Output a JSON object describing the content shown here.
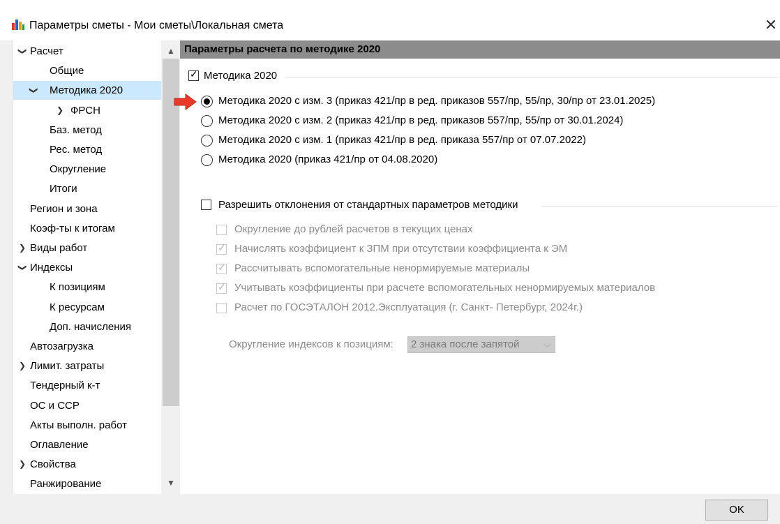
{
  "window": {
    "title": "Параметры сметы - Мои сметы\\Локальная смета",
    "close_symbol": "✕",
    "app_icon": "chart-app-icon"
  },
  "tree": {
    "items": [
      {
        "label": "Расчет",
        "arrow": "❯",
        "arrow_state": "expanded"
      },
      {
        "label": "Общие"
      },
      {
        "label": "Методика 2020",
        "arrow": "❯",
        "arrow_state": "expanded",
        "selected": true
      },
      {
        "label": "ФРСН",
        "arrow": "❯",
        "arrow_state": "collapsed"
      },
      {
        "label": "Баз. метод"
      },
      {
        "label": "Рес. метод"
      },
      {
        "label": "Округление"
      },
      {
        "label": "Итоги"
      },
      {
        "label": "Регион и зона"
      },
      {
        "label": "Коэф-ты к итогам"
      },
      {
        "label": "Виды работ",
        "arrow": "❯",
        "arrow_state": "collapsed"
      },
      {
        "label": "Индексы",
        "arrow": "❯",
        "arrow_state": "expanded"
      },
      {
        "label": "К позициям"
      },
      {
        "label": "К ресурсам"
      },
      {
        "label": "Доп. начисления"
      },
      {
        "label": "Автозагрузка"
      },
      {
        "label": "Лимит. затраты",
        "arrow": "❯",
        "arrow_state": "collapsed"
      },
      {
        "label": "Тендерный к-т"
      },
      {
        "label": "ОС и ССР"
      },
      {
        "label": "Акты выполн. работ"
      },
      {
        "label": "Оглавление"
      },
      {
        "label": "Свойства",
        "arrow": "❯",
        "arrow_state": "collapsed"
      },
      {
        "label": "Ранжирование"
      }
    ]
  },
  "panel": {
    "header": "Параметры расчета по методике 2020",
    "methodology_checkbox": {
      "label": "Методика 2020",
      "checked": true
    },
    "radios": [
      {
        "label": "Методика 2020 с изм. 3 (приказ 421/пр в ред. приказов 557/пр, 55/пр, 30/пр от 23.01.2025)",
        "selected": true
      },
      {
        "label": "Методика 2020 с изм. 2 (приказ 421/пр в ред. приказов 557/пр, 55/пр от 30.01.2024)",
        "selected": false
      },
      {
        "label": "Методика 2020 с изм. 1 (приказ 421/пр в ред. приказа 557/пр от 07.07.2022)",
        "selected": false
      },
      {
        "label": "Методика 2020 (приказ 421/пр от 04.08.2020)",
        "selected": false
      }
    ],
    "allow_deviations": {
      "label": "Разрешить отклонения от стандартных параметров методики",
      "checked": false
    },
    "options": [
      {
        "label": "Округление до рублей расчетов в текущих ценах",
        "checked": false
      },
      {
        "label": "Начислять коэффициент к ЗПМ при отсутствии коэффициента к ЭМ",
        "checked": true
      },
      {
        "label": "Рассчитывать вспомогательные ненормируемые материалы",
        "checked": true
      },
      {
        "label": "Учитывать коэффициенты при расчете вспомогательных ненормируемых материалов",
        "checked": true
      },
      {
        "label": "Расчет по ГОСЭТАЛОН 2012.Эксплуатация (г. Санкт- Петербург, 2024г.)",
        "checked": false
      }
    ],
    "rounding": {
      "label": "Округление индексов к позициям:",
      "value": "2 знака после запятой"
    }
  },
  "buttons": {
    "ok": "OK"
  },
  "colors": {
    "selected_row": "#cce8ff",
    "header_bg": "#8c8c8c",
    "arrow_red": "#e8392a"
  }
}
